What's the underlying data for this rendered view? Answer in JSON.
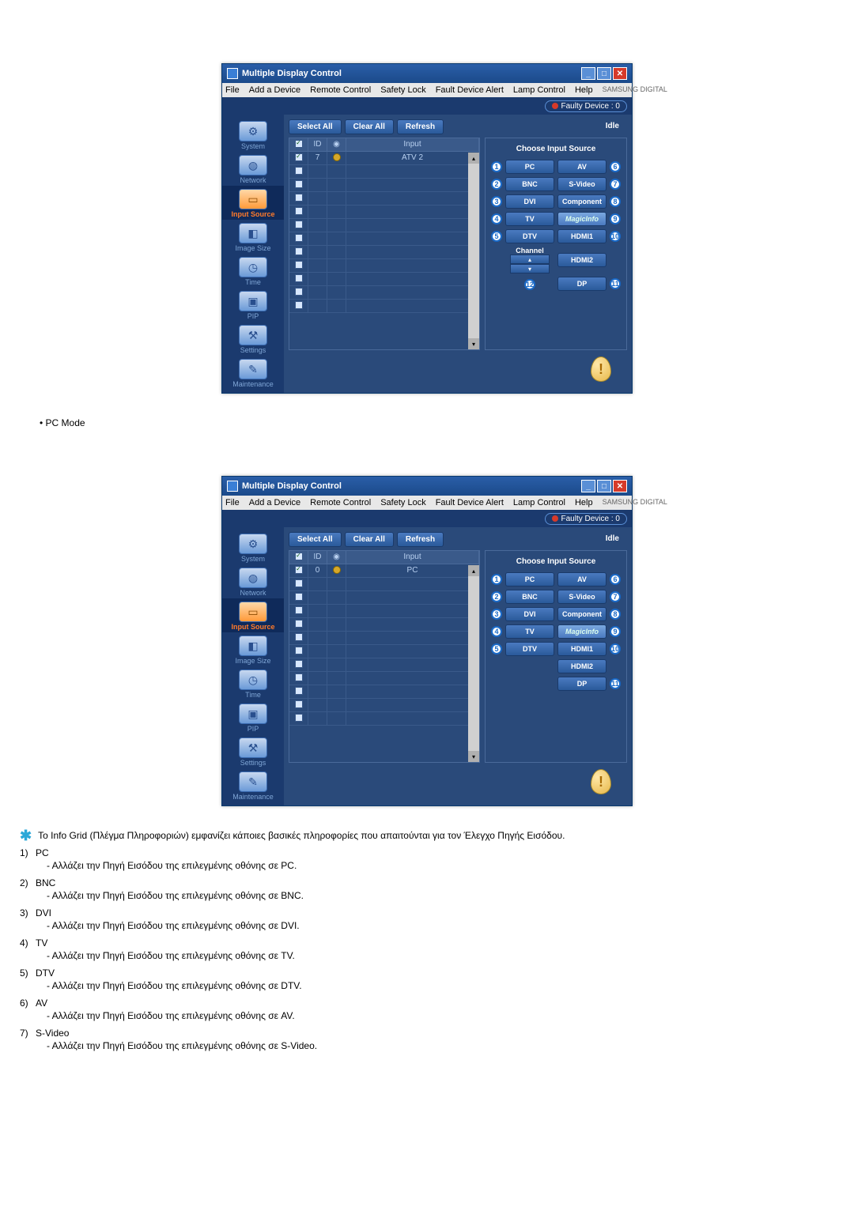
{
  "app": {
    "title": "Multiple Display Control",
    "menus": [
      "File",
      "Add a Device",
      "Remote Control",
      "Safety Lock",
      "Fault Device Alert",
      "Lamp Control",
      "Help"
    ],
    "brand": "SAMSUNG DIGITAL",
    "faulty": "Faulty Device : 0",
    "buttons": {
      "select_all": "Select All",
      "clear_all": "Clear All",
      "refresh": "Refresh"
    },
    "idle": "Idle",
    "sidebar": [
      {
        "label": "System",
        "icon": "⚙"
      },
      {
        "label": "Network",
        "icon": "○"
      },
      {
        "label": "Input Source",
        "icon": "▭",
        "active": true
      },
      {
        "label": "Image Size",
        "icon": "◧"
      },
      {
        "label": "Time",
        "icon": "◷"
      },
      {
        "label": "PIP",
        "icon": "▣"
      },
      {
        "label": "Settings",
        "icon": "⚒"
      },
      {
        "label": "Maintenance",
        "icon": "✎"
      }
    ],
    "grid_headers": {
      "chk": "☑",
      "id": "ID",
      "stat": " ",
      "input": "Input"
    },
    "source_title": "Choose Input Source",
    "sources_left": [
      {
        "n": "1",
        "label": "PC"
      },
      {
        "n": "2",
        "label": "BNC"
      },
      {
        "n": "3",
        "label": "DVI"
      },
      {
        "n": "4",
        "label": "TV"
      },
      {
        "n": "5",
        "label": "DTV"
      }
    ],
    "sources_right": [
      {
        "n": "6",
        "label": "AV"
      },
      {
        "n": "7",
        "label": "S-Video"
      },
      {
        "n": "8",
        "label": "Component"
      },
      {
        "n": "9",
        "label": "MagicInfo"
      },
      {
        "n": "10",
        "label": "HDMI1"
      },
      {
        "n": "",
        "label": "HDMI2"
      },
      {
        "n": "11",
        "label": "DP"
      }
    ],
    "channel_label": "Channel",
    "channel_num": "12"
  },
  "screenshot1": {
    "row": {
      "id": "7",
      "input": "ATV 2"
    }
  },
  "screenshot2": {
    "row": {
      "id": "0",
      "input": "PC"
    }
  },
  "text": {
    "pc_mode": "PC Mode",
    "info_grid": "Το Info Grid (Πλέγμα Πληροφοριών) εμφανίζει κάποιες βασικές πληροφορίες που απαιτούνται για τον Έλεγχο Πηγής Εισόδου.",
    "items": [
      {
        "n": "1)",
        "label": "PC",
        "sub": "- Αλλάζει την Πηγή Εισόδου της επιλεγμένης οθόνης σε PC."
      },
      {
        "n": "2)",
        "label": "BNC",
        "sub": "- Αλλάζει την Πηγή Εισόδου της επιλεγμένης οθόνης σε BNC."
      },
      {
        "n": "3)",
        "label": "DVI",
        "sub": "- Αλλάζει την Πηγή Εισόδου της επιλεγμένης οθόνης σε DVI."
      },
      {
        "n": "4)",
        "label": "TV",
        "sub": "- Αλλάζει την Πηγή Εισόδου της επιλεγμένης οθόνης σε TV."
      },
      {
        "n": "5)",
        "label": "DTV",
        "sub": "- Αλλάζει την Πηγή Εισόδου της επιλεγμένης οθόνης σε DTV."
      },
      {
        "n": "6)",
        "label": "AV",
        "sub": "- Αλλάζει την Πηγή Εισόδου της επιλεγμένης οθόνης σε AV."
      },
      {
        "n": "7)",
        "label": "S-Video",
        "sub": "- Αλλάζει την Πηγή Εισόδου της επιλεγμένης οθόνης σε S-Video."
      }
    ]
  }
}
